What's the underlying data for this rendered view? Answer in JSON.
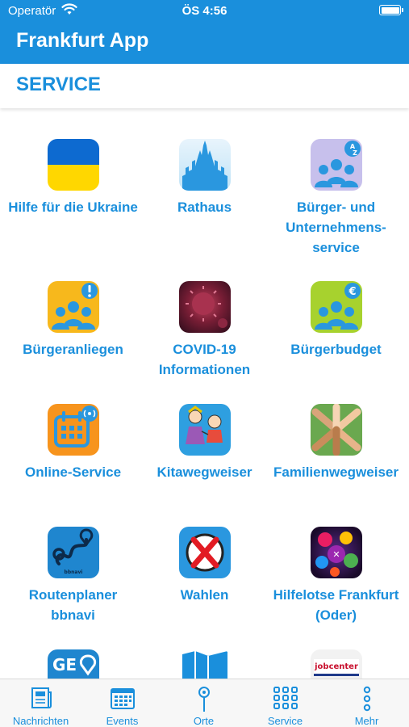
{
  "status_bar": {
    "carrier": "Operatör",
    "time": "ÖS 4:56"
  },
  "header": {
    "title": "Frankfurt App"
  },
  "section": {
    "title": "SERVICE"
  },
  "tiles": [
    {
      "label": "Hilfe für die Ukraine",
      "icon": "ukraine-flag-icon"
    },
    {
      "label": "Rathaus",
      "icon": "town-hall-icon"
    },
    {
      "label": "Bürger- und Unternehmens-service",
      "icon": "citizens-az-icon"
    },
    {
      "label": "Bürgeranliegen",
      "icon": "citizens-alert-icon"
    },
    {
      "label": "COVID-19 Informationen",
      "icon": "virus-icon"
    },
    {
      "label": "Bürgerbudget",
      "icon": "citizens-euro-icon"
    },
    {
      "label": "Online-Service",
      "icon": "calendar-icon"
    },
    {
      "label": "Kitawegweiser",
      "icon": "children-drawing-icon"
    },
    {
      "label": "Familienwegweiser",
      "icon": "joined-hands-icon"
    },
    {
      "label": "Routenplaner bbnavi",
      "icon": "route-icon"
    },
    {
      "label": "Wahlen",
      "icon": "ballot-cross-icon"
    },
    {
      "label": "Hilfelotse Frankfurt (Oder)",
      "icon": "help-bubbles-icon"
    },
    {
      "label": "",
      "icon": "geo-map-icon"
    },
    {
      "label": "",
      "icon": "map-book-icon"
    },
    {
      "label": "",
      "icon": "jobcenter-icon",
      "logo_text": "jobcenter"
    }
  ],
  "tabbar": {
    "tabs": [
      {
        "label": "Nachrichten",
        "icon": "newspaper-icon"
      },
      {
        "label": "Events",
        "icon": "calendar-grid-icon"
      },
      {
        "label": "Orte",
        "icon": "map-pin-icon"
      },
      {
        "label": "Service",
        "icon": "grid-dots-icon"
      },
      {
        "label": "Mehr",
        "icon": "more-dots-icon"
      }
    ]
  },
  "colors": {
    "accent": "#1a8fdc",
    "header_bg": "#1a8fdc",
    "tabbar_bg": "#f7f7f7"
  }
}
